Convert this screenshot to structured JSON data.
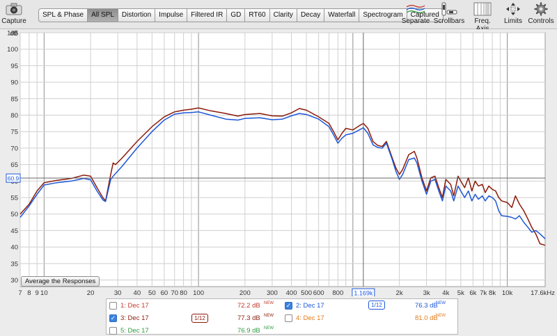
{
  "toolbar": {
    "capture_label": "Capture",
    "tabs": [
      "SPL & Phase",
      "All SPL",
      "Distortion",
      "Impulse",
      "Filtered IR",
      "GD",
      "RT60",
      "Clarity",
      "Decay",
      "Waterfall",
      "Spectrogram",
      "Captured"
    ],
    "active_tab": "All SPL",
    "separate_label": "Separate",
    "scrollbars_label": "Scrollbars",
    "freq_axis_label": "Freq. Axis",
    "limits_label": "Limits",
    "controls_label": "Controls"
  },
  "chart_data": {
    "type": "line",
    "yunit": "dB",
    "ylim": [
      28,
      105
    ],
    "xscale": "log",
    "xlim": [
      7,
      17600
    ],
    "yticks": [
      "105",
      "100",
      "95",
      "90",
      "85",
      "80",
      "75",
      "70",
      "65",
      "60",
      "55",
      "50",
      "45",
      "40",
      "35",
      "30"
    ],
    "xticks": [
      {
        "v": 7,
        "t": "7"
      },
      {
        "v": 8,
        "t": "8"
      },
      {
        "v": 9,
        "t": "9"
      },
      {
        "v": 10,
        "t": "10"
      },
      {
        "v": 20,
        "t": "20"
      },
      {
        "v": 30,
        "t": "30"
      },
      {
        "v": 40,
        "t": "40"
      },
      {
        "v": 50,
        "t": "50"
      },
      {
        "v": 60,
        "t": "60"
      },
      {
        "v": 70,
        "t": "70"
      },
      {
        "v": 80,
        "t": "80"
      },
      {
        "v": 100,
        "t": "100"
      },
      {
        "v": 200,
        "t": "200"
      },
      {
        "v": 300,
        "t": "300"
      },
      {
        "v": 400,
        "t": "400"
      },
      {
        "v": 500,
        "t": "500"
      },
      {
        "v": 600,
        "t": "600"
      },
      {
        "v": 800,
        "t": "800"
      },
      {
        "v": 2000,
        "t": "2k"
      },
      {
        "v": 3000,
        "t": "3k"
      },
      {
        "v": 4000,
        "t": "4k"
      },
      {
        "v": 5000,
        "t": "5k"
      },
      {
        "v": 6000,
        "t": "6k"
      },
      {
        "v": 7000,
        "t": "7k"
      },
      {
        "v": 8000,
        "t": "8k"
      },
      {
        "v": 10000,
        "t": "10k"
      },
      {
        "v": 17600,
        "t": "17.6kHz"
      }
    ],
    "cursor": {
      "x": 1169,
      "x_label": "1.169k",
      "y": 60.9,
      "y_label": "60.9"
    },
    "series": [
      {
        "color": "#8b1a0a",
        "points": [
          [
            7,
            50
          ],
          [
            8,
            53
          ],
          [
            9,
            57
          ],
          [
            10,
            59.5
          ],
          [
            12,
            60.2
          ],
          [
            15,
            60.8
          ],
          [
            18,
            61.8
          ],
          [
            20,
            61.5
          ],
          [
            22,
            58
          ],
          [
            24,
            55
          ],
          [
            25,
            54
          ],
          [
            27,
            62
          ],
          [
            28,
            65.5
          ],
          [
            29,
            65
          ],
          [
            32,
            67
          ],
          [
            40,
            72
          ],
          [
            50,
            76.5
          ],
          [
            60,
            79.5
          ],
          [
            70,
            81
          ],
          [
            80,
            81.5
          ],
          [
            90,
            81.8
          ],
          [
            100,
            82.2
          ],
          [
            120,
            81.3
          ],
          [
            150,
            80.5
          ],
          [
            180,
            79.7
          ],
          [
            200,
            80.2
          ],
          [
            250,
            80.5
          ],
          [
            300,
            79.8
          ],
          [
            350,
            79.7
          ],
          [
            400,
            80.7
          ],
          [
            450,
            82
          ],
          [
            500,
            81.5
          ],
          [
            600,
            79.5
          ],
          [
            700,
            77.5
          ],
          [
            750,
            75
          ],
          [
            800,
            72.5
          ],
          [
            850,
            74.5
          ],
          [
            900,
            76
          ],
          [
            1000,
            75.5
          ],
          [
            1100,
            76.8
          ],
          [
            1169,
            77.5
          ],
          [
            1250,
            76
          ],
          [
            1350,
            72
          ],
          [
            1450,
            70.8
          ],
          [
            1550,
            70.5
          ],
          [
            1650,
            72
          ],
          [
            1800,
            67
          ],
          [
            1900,
            64
          ],
          [
            2000,
            62
          ],
          [
            2100,
            63.5
          ],
          [
            2300,
            68
          ],
          [
            2500,
            69
          ],
          [
            2600,
            67
          ],
          [
            2800,
            61
          ],
          [
            3000,
            57
          ],
          [
            3200,
            61
          ],
          [
            3400,
            61.5
          ],
          [
            3600,
            58
          ],
          [
            3800,
            55
          ],
          [
            4000,
            60.5
          ],
          [
            4300,
            59
          ],
          [
            4500,
            55.5
          ],
          [
            4800,
            61.5
          ],
          [
            5000,
            60
          ],
          [
            5300,
            58
          ],
          [
            5600,
            61
          ],
          [
            5900,
            57
          ],
          [
            6200,
            60
          ],
          [
            6500,
            58.5
          ],
          [
            6900,
            59
          ],
          [
            7200,
            56.5
          ],
          [
            7600,
            58.5
          ],
          [
            8000,
            57.5
          ],
          [
            8400,
            57
          ],
          [
            8800,
            55
          ],
          [
            9200,
            54
          ],
          [
            10000,
            53.5
          ],
          [
            10700,
            52
          ],
          [
            11300,
            55.5
          ],
          [
            12000,
            53
          ],
          [
            12800,
            51
          ],
          [
            13600,
            48.5
          ],
          [
            14400,
            46
          ],
          [
            15300,
            44
          ],
          [
            16300,
            41
          ],
          [
            17600,
            40.5
          ]
        ]
      },
      {
        "color": "#1c56d8",
        "points": [
          [
            7,
            49
          ],
          [
            8,
            52.5
          ],
          [
            9,
            56
          ],
          [
            10,
            58.8
          ],
          [
            12,
            59.5
          ],
          [
            15,
            60
          ],
          [
            18,
            60.8
          ],
          [
            20,
            60.4
          ],
          [
            22,
            57
          ],
          [
            24,
            54.3
          ],
          [
            25,
            53.8
          ],
          [
            27,
            60.5
          ],
          [
            28,
            61.5
          ],
          [
            32,
            64.5
          ],
          [
            40,
            70
          ],
          [
            50,
            75
          ],
          [
            60,
            78.5
          ],
          [
            70,
            80.3
          ],
          [
            80,
            80.7
          ],
          [
            90,
            80.8
          ],
          [
            100,
            81
          ],
          [
            120,
            80
          ],
          [
            150,
            78.8
          ],
          [
            180,
            78.5
          ],
          [
            200,
            79
          ],
          [
            250,
            79.2
          ],
          [
            300,
            78.6
          ],
          [
            350,
            78.8
          ],
          [
            400,
            79.8
          ],
          [
            450,
            80.5
          ],
          [
            500,
            80.2
          ],
          [
            600,
            78.8
          ],
          [
            700,
            76.5
          ],
          [
            750,
            74
          ],
          [
            800,
            71.5
          ],
          [
            850,
            73
          ],
          [
            900,
            74
          ],
          [
            1000,
            74.5
          ],
          [
            1100,
            75.5
          ],
          [
            1169,
            76.2
          ],
          [
            1250,
            74.5
          ],
          [
            1350,
            71
          ],
          [
            1450,
            70.2
          ],
          [
            1550,
            70
          ],
          [
            1650,
            71.5
          ],
          [
            1800,
            66.5
          ],
          [
            1900,
            63
          ],
          [
            2000,
            60.5
          ],
          [
            2100,
            62
          ],
          [
            2300,
            66.5
          ],
          [
            2500,
            67
          ],
          [
            2600,
            65.5
          ],
          [
            2800,
            60
          ],
          [
            3000,
            56
          ],
          [
            3200,
            60
          ],
          [
            3400,
            60.5
          ],
          [
            3600,
            57
          ],
          [
            3800,
            54
          ],
          [
            4000,
            58.5
          ],
          [
            4300,
            57
          ],
          [
            4500,
            54
          ],
          [
            4800,
            58.5
          ],
          [
            5000,
            57
          ],
          [
            5300,
            55
          ],
          [
            5600,
            57
          ],
          [
            5900,
            54
          ],
          [
            6200,
            56
          ],
          [
            6500,
            54.5
          ],
          [
            6900,
            55.5
          ],
          [
            7200,
            54
          ],
          [
            7600,
            55.5
          ],
          [
            8000,
            55
          ],
          [
            8400,
            54
          ],
          [
            8800,
            51
          ],
          [
            9200,
            49.5
          ],
          [
            10000,
            49.3
          ],
          [
            10700,
            49
          ],
          [
            11300,
            48.5
          ],
          [
            12000,
            49.5
          ],
          [
            12800,
            47.5
          ],
          [
            13600,
            46
          ],
          [
            14400,
            44.5
          ],
          [
            15300,
            45
          ],
          [
            16300,
            44
          ],
          [
            17600,
            42.5
          ]
        ]
      }
    ]
  },
  "controls": {
    "average_button": "Average the Responses"
  },
  "legend": {
    "rows": [
      {
        "label": "1: Dec 17",
        "value": "72.2 dB",
        "badge": "NEW",
        "color": "#c0392b",
        "checked": false
      },
      {
        "label": "2: Dec 17",
        "value": "76.3 dB",
        "badge": "NEW",
        "color": "#1c56d8",
        "checked": true,
        "smoothing": "1/12"
      },
      {
        "label": "3: Dec 17",
        "value": "77.3 dB",
        "badge": "NEW",
        "color": "#8b1a0a",
        "checked": true,
        "smoothing": "1/12"
      },
      {
        "label": "4: Dec 17",
        "value": "81.0 dB",
        "badge": "NEW",
        "color": "#e07b1a",
        "checked": false
      },
      {
        "label": "5: Dec 17",
        "value": "76.9 dB",
        "badge": "NEW",
        "color": "#2e9a3c",
        "checked": false
      }
    ]
  }
}
